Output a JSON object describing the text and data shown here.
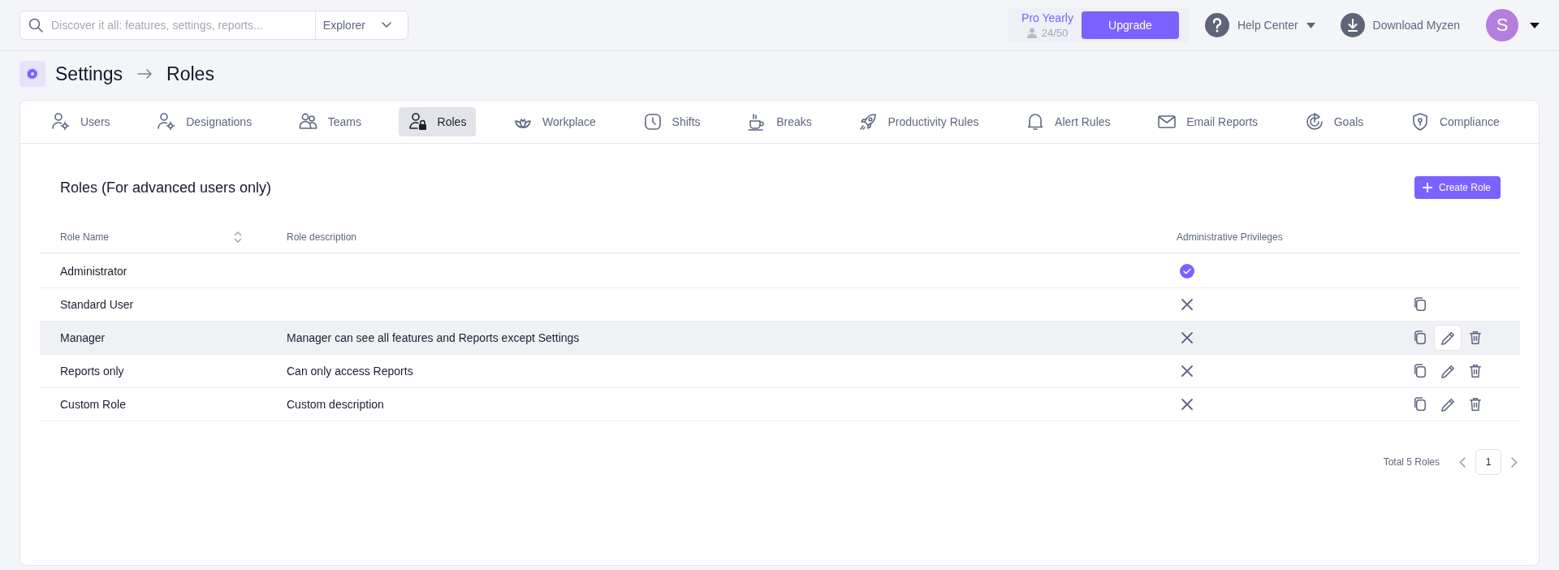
{
  "search": {
    "placeholder": "Discover it all: features, settings, reports...",
    "scope": "Explorer"
  },
  "plan": {
    "name": "Pro Yearly",
    "seats": "24/50",
    "upgrade": "Upgrade"
  },
  "help": "Help Center",
  "download": "Download Myzen",
  "avatar": "S",
  "breadcrumb": [
    "Settings",
    "Roles"
  ],
  "tabs": [
    {
      "label": "Users",
      "selected": false
    },
    {
      "label": "Designations",
      "selected": false
    },
    {
      "label": "Teams",
      "selected": false
    },
    {
      "label": "Roles",
      "selected": true
    },
    {
      "label": "Workplace",
      "selected": false
    },
    {
      "label": "Shifts",
      "selected": false
    },
    {
      "label": "Breaks",
      "selected": false
    },
    {
      "label": "Productivity Rules",
      "selected": false
    },
    {
      "label": "Alert Rules",
      "selected": false
    },
    {
      "label": "Email Reports",
      "selected": false
    },
    {
      "label": "Goals",
      "selected": false
    },
    {
      "label": "Compliance",
      "selected": false
    }
  ],
  "section_title": "Roles (For advanced users only)",
  "create_button": "Create Role",
  "table": {
    "columns": [
      "Role Name",
      "Role description",
      "Administrative Privileges"
    ],
    "rows": [
      {
        "name": "Administrator",
        "description": "",
        "admin": true,
        "highlighted": false,
        "actions": []
      },
      {
        "name": "Standard User",
        "description": "",
        "admin": false,
        "highlighted": false,
        "actions": [
          {
            "kind": "copy",
            "hovered": false
          }
        ]
      },
      {
        "name": "Manager",
        "description": "Manager can see all features and Reports except Settings",
        "admin": false,
        "highlighted": true,
        "actions": [
          {
            "kind": "copy",
            "hovered": false
          },
          {
            "kind": "edit",
            "hovered": true
          },
          {
            "kind": "delete",
            "hovered": false
          }
        ]
      },
      {
        "name": "Reports only",
        "description": "Can only access Reports",
        "admin": false,
        "highlighted": false,
        "actions": [
          {
            "kind": "copy",
            "hovered": false
          },
          {
            "kind": "edit",
            "hovered": false
          },
          {
            "kind": "delete",
            "hovered": false
          }
        ]
      },
      {
        "name": "Custom Role",
        "description": "Custom description",
        "admin": false,
        "highlighted": false,
        "actions": [
          {
            "kind": "copy",
            "hovered": false
          },
          {
            "kind": "edit",
            "hovered": false
          },
          {
            "kind": "delete",
            "hovered": false
          }
        ]
      }
    ]
  },
  "pagination": {
    "total": "Total 5 Roles",
    "pages": [
      {
        "label": "1",
        "selected": true
      }
    ]
  }
}
